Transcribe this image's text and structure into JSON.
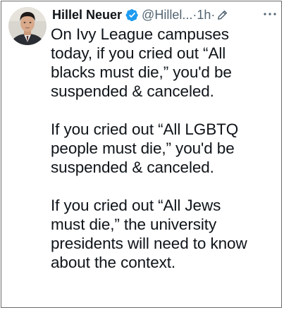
{
  "tweet": {
    "author": {
      "display_name": "Hillel Neuer",
      "handle": "@Hillel...",
      "verified_icon": "verified-badge-icon",
      "avatar": "profile-photo"
    },
    "separator": "·",
    "time": "1h",
    "time_separator": "·",
    "edit_icon": "pencil-icon",
    "more_icon": "more-dots-icon",
    "paragraphs": [
      {
        "lines": [
          "On Ivy League campuses",
          "today, if you cried out “All",
          "blacks must die,” you'd be",
          "suspended & canceled."
        ]
      },
      {
        "lines": [
          "If you cried out “All LGBTQ",
          "people must die,” you'd be",
          "suspended & canceled."
        ]
      },
      {
        "lines": [
          "If you cried out “All Jews",
          "must die,” the university",
          "presidents will need to know",
          "about the context."
        ]
      }
    ]
  },
  "colors": {
    "text": "#0f1419",
    "secondary_text": "#536471",
    "verified_blue": "#1d9bf0",
    "border": "#6b6b6b"
  }
}
